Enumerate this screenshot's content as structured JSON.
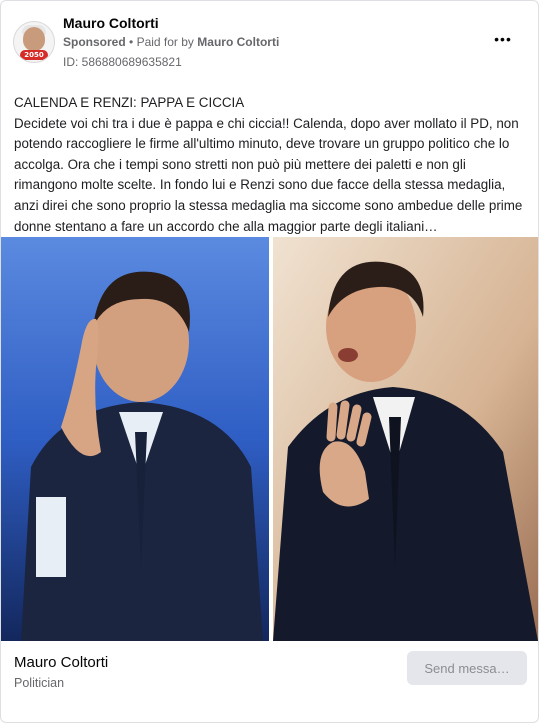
{
  "post": {
    "author": "Mauro Coltorti",
    "sponsored_label": "Sponsored",
    "paid_prefix": "Paid for by",
    "paid_by": "Mauro Coltorti",
    "ad_id": "ID: 586880689635821",
    "avatar_badge": "2050",
    "more_icon": "•••",
    "headline": "CALENDA E RENZI: PAPPA E CICCIA",
    "body": "Decidete voi chi tra i due è pappa e chi ciccia!! Calenda, dopo aver mollato il PD, non potendo raccogliere le firme all'ultimo minuto, deve trovare un gruppo politico che lo accolga. Ora che i tempi sono stretti non può più mettere dei paletti e non gli rimangono molte scelte. In fondo lui e Renzi sono due facce della stessa medaglia, anzi direi che sono proprio la stessa medaglia ma siccome sono ambedue delle prime donne stentano a fare un accordo che alla maggior parte degli italiani…"
  },
  "footer": {
    "page_name": "Mauro Coltorti",
    "page_category": "Politician",
    "cta_label": "Send messa…"
  },
  "colors": {
    "text_primary": "#050505",
    "text_secondary": "#65676b",
    "button_bg": "#e4e6eb"
  }
}
